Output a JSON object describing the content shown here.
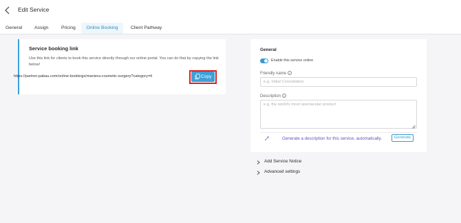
{
  "header": {
    "title": "Edit Service",
    "back_icon": "chevron-left-icon"
  },
  "tabs": [
    {
      "label": "General"
    },
    {
      "label": "Assign"
    },
    {
      "label": "Pricing"
    },
    {
      "label": "Online Booking",
      "active": true
    },
    {
      "label": "Client Pathway"
    }
  ],
  "booking_link": {
    "title": "Service booking link",
    "description": "Use this link for clients to book this service directly through our online portal. You can do that by copying the link below!",
    "url": "https://partner.pabau.com/online-bookings/maniera-cosmetic-surgery?category=tl",
    "copy_label": "Copy",
    "copy_icon": "copy-icon"
  },
  "general": {
    "title": "General",
    "enable_toggle": {
      "label": "Enable this service online",
      "on": true
    },
    "friendly_name": {
      "label": "Friendly name",
      "placeholder": "e.g. Initial Consultation",
      "value": ""
    },
    "description": {
      "label": "Description",
      "placeholder": "e.g. the world's most spectacular product",
      "value": ""
    },
    "generate": {
      "text": "Generate a description for this service, automatically.",
      "button_label": "Generate",
      "icon": "magic-wand-icon"
    }
  },
  "expanders": [
    {
      "label": "Add Service Notice"
    },
    {
      "label": "Advanced settings"
    }
  ],
  "colors": {
    "accent": "#3a9ad0",
    "highlight_border": "#d92020",
    "ai_text": "#6a4fbf",
    "page_bg": "#f5f5f7"
  }
}
